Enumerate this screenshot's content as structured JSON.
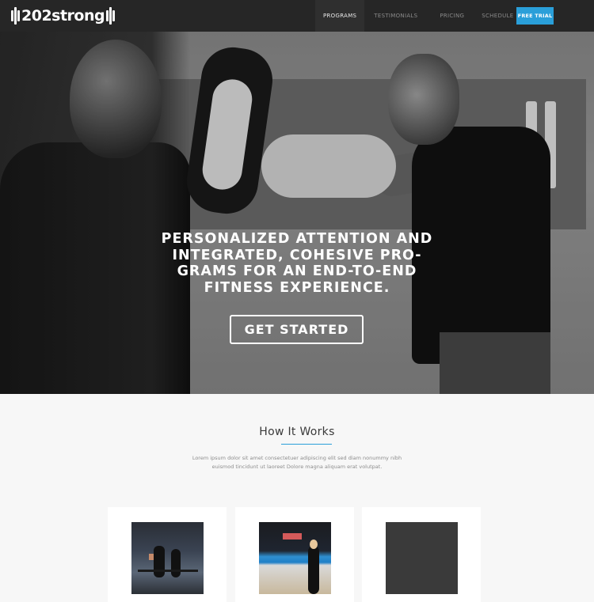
{
  "nav": {
    "logo_text": "202strong",
    "items": [
      {
        "label": "PROGRAMS",
        "active": true
      },
      {
        "label": "TESTIMONIALS",
        "active": false
      },
      {
        "label": "PRICING",
        "active": false
      },
      {
        "label": "SCHEDULE",
        "active": false
      }
    ],
    "cta_label": "FREE TRIAL"
  },
  "hero": {
    "headline": "PERSONALIZED ATTENTION AND INTEGRATED, COHESIVE PRO-GRAMS FOR AN END-TO-END FITNESS EXPERIENCE.",
    "button_label": "GET STARTED"
  },
  "how_it_works": {
    "title": "How It Works",
    "description": "Lorem ipsum dolor sit amet consectetuer adipiscing elit sed diam nonummy nibh euismod tincidunt ut laoreet Dolore magna aliquam erat volutpat."
  },
  "colors": {
    "accent": "#2a9fd9",
    "nav_bg": "#262626",
    "page_bg": "#f7f7f7"
  }
}
